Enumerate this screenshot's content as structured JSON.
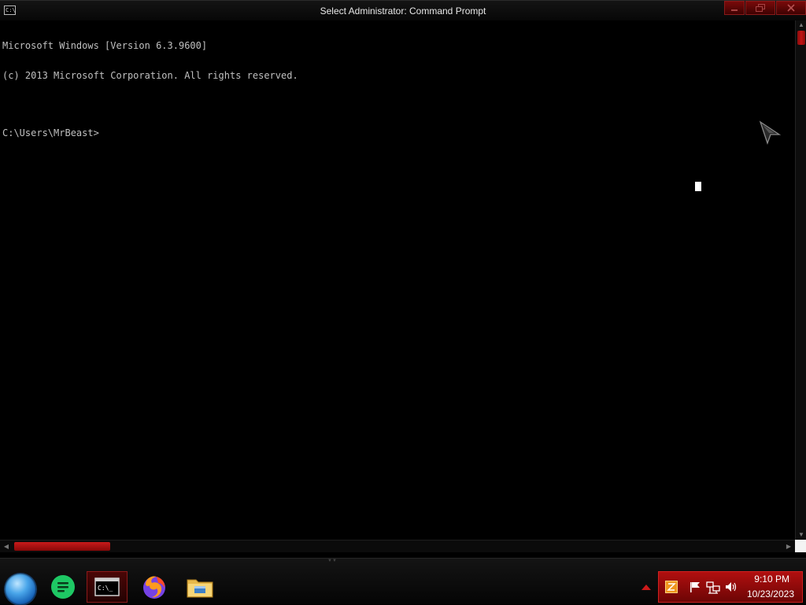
{
  "window": {
    "title": "Select Administrator: Command Prompt",
    "icon_text": "C:\\"
  },
  "console": {
    "lines": [
      "Microsoft Windows [Version 6.3.9600]",
      "(c) 2013 Microsoft Corporation. All rights reserved.",
      "",
      "C:\\Users\\MrBeast>"
    ]
  },
  "taskbar": {
    "apps": [
      {
        "name": "start-button",
        "icon": "windows-orb-icon"
      },
      {
        "name": "notes-app",
        "icon": "notes-icon"
      },
      {
        "name": "command-prompt",
        "icon": "cmd-icon",
        "label": "C:\\_"
      },
      {
        "name": "firefox",
        "icon": "firefox-icon"
      },
      {
        "name": "file-explorer",
        "icon": "folder-icon"
      }
    ],
    "clock": {
      "time": "9:10 PM",
      "date": "10/23/2023"
    }
  },
  "colors": {
    "accent": "#b10f0f",
    "console_text": "#c0c0c0",
    "background": "#000000"
  }
}
